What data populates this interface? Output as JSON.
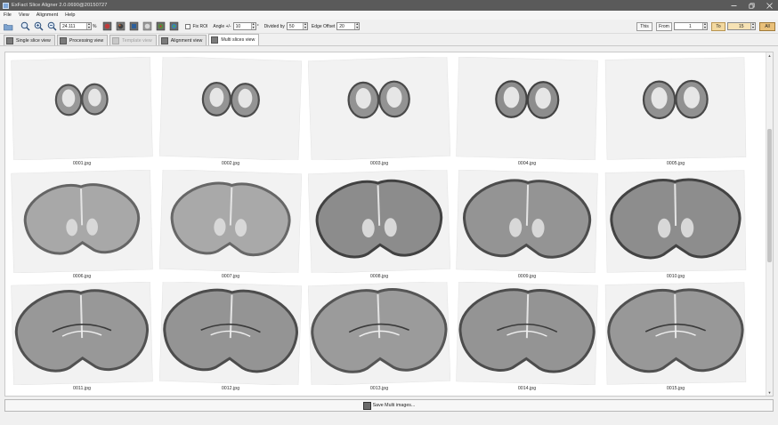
{
  "window": {
    "title": "ExFact Slice Aligner 2.0.0690@20150727"
  },
  "menu": [
    "File",
    "View",
    "Alignment",
    "Help"
  ],
  "toolbar": {
    "zoom_value": "24.111",
    "zoom_suffix": "%",
    "fix_roi_label": "Fix ROI",
    "angle_label": "Angle +/-",
    "angle_value": "10",
    "angle_unit": "°",
    "divided_label": "Divided by",
    "divided_value": "50",
    "edge_label": "Edge Offset",
    "edge_value": "20",
    "this_label": "This",
    "from_label": "From",
    "from_value": "1",
    "to_label": "To",
    "to_value": "15",
    "all_label": "All"
  },
  "tabs": [
    {
      "label": "Single slice view",
      "state": "normal"
    },
    {
      "label": "Processing view",
      "state": "normal"
    },
    {
      "label": "Template view",
      "state": "disabled"
    },
    {
      "label": "Alignment view",
      "state": "normal"
    },
    {
      "label": "Multi slices view",
      "state": "active"
    }
  ],
  "images": [
    {
      "file": "0001.jpg",
      "size": 0.28,
      "tone": 0.55,
      "shape": "olfactory"
    },
    {
      "file": "0002.jpg",
      "size": 0.34,
      "tone": 0.6,
      "shape": "olfactory"
    },
    {
      "file": "0003.jpg",
      "size": 0.4,
      "tone": 0.62,
      "shape": "olfactory"
    },
    {
      "file": "0004.jpg",
      "size": 0.42,
      "tone": 0.7,
      "shape": "olfactory"
    },
    {
      "file": "0005.jpg",
      "size": 0.44,
      "tone": 0.65,
      "shape": "olfactory"
    },
    {
      "file": "0006.jpg",
      "size": 0.62,
      "tone": 0.32,
      "shape": "frontal"
    },
    {
      "file": "0007.jpg",
      "size": 0.68,
      "tone": 0.3,
      "shape": "frontal"
    },
    {
      "file": "0008.jpg",
      "size": 0.78,
      "tone": 0.72,
      "shape": "frontal"
    },
    {
      "file": "0009.jpg",
      "size": 0.8,
      "tone": 0.6,
      "shape": "frontal"
    },
    {
      "file": "0010.jpg",
      "size": 0.84,
      "tone": 0.7,
      "shape": "frontal"
    },
    {
      "file": "0011.jpg",
      "size": 0.88,
      "tone": 0.55,
      "shape": "coronal"
    },
    {
      "file": "0012.jpg",
      "size": 0.9,
      "tone": 0.6,
      "shape": "coronal"
    },
    {
      "file": "0013.jpg",
      "size": 0.92,
      "tone": 0.5,
      "shape": "coronal"
    },
    {
      "file": "0014.jpg",
      "size": 0.92,
      "tone": 0.6,
      "shape": "coronal"
    },
    {
      "file": "0015.jpg",
      "size": 0.92,
      "tone": 0.55,
      "shape": "coronal"
    }
  ],
  "footer": {
    "save_label": "Save Multi images..."
  }
}
